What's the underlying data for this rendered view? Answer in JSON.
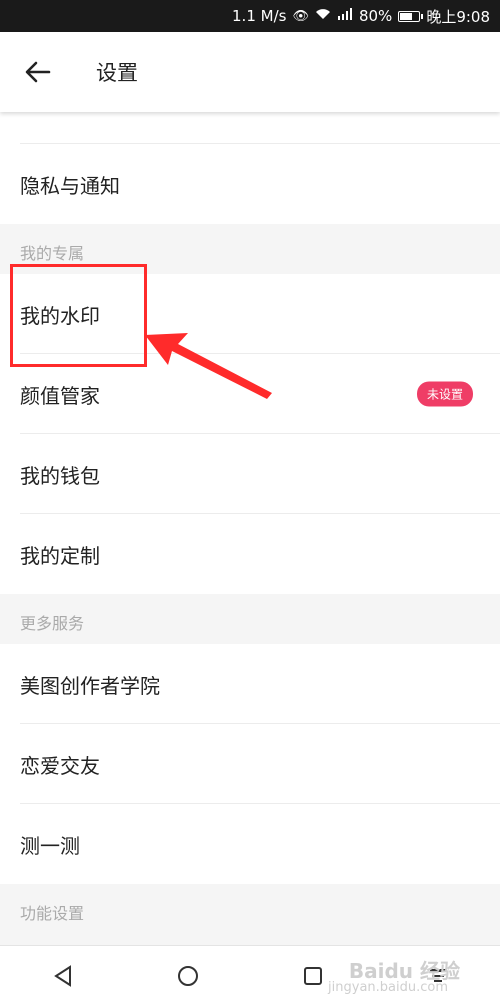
{
  "status_bar": {
    "speed": "1.1 M/s",
    "signal": "4G",
    "battery": "80%",
    "time": "晚上9:08"
  },
  "header": {
    "title": "设置"
  },
  "items": {
    "privacy": "隐私与通知",
    "section_mine": "我的专属",
    "watermark": "我的水印",
    "beauty": "颜值管家",
    "beauty_badge": "未设置",
    "wallet": "我的钱包",
    "custom": "我的定制",
    "section_more": "更多服务",
    "academy": "美图创作者学院",
    "dating": "恋爱交友",
    "test": "测一测",
    "section_func": "功能设置"
  },
  "watermark_brand": {
    "text": "Baidu 经验",
    "url": "jingyan.baidu.com"
  },
  "colors": {
    "accent": "#ef3d66",
    "highlight": "#ff2b2b"
  }
}
